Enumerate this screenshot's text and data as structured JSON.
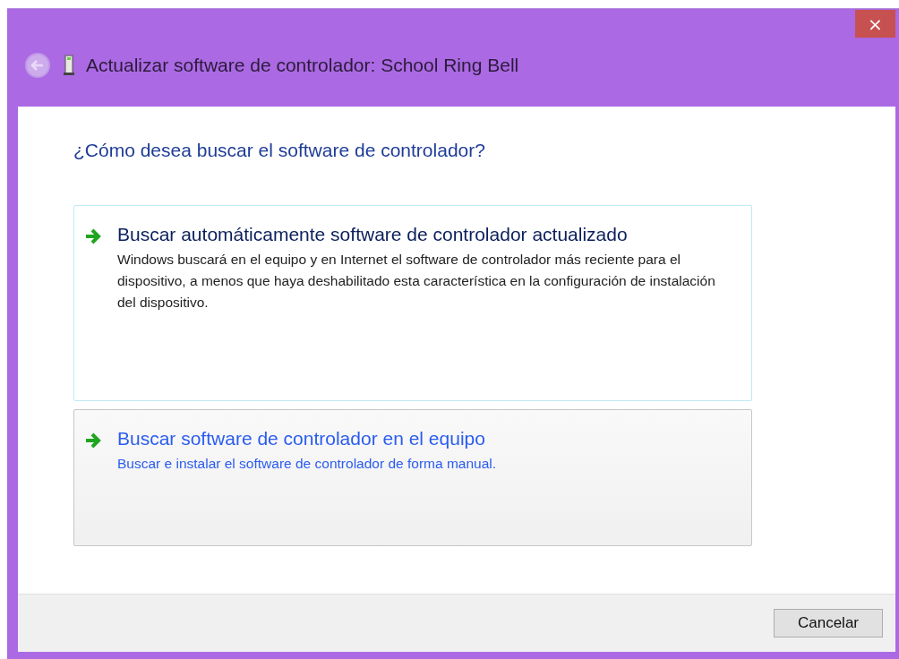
{
  "window": {
    "title": "Actualizar software de controlador: School Ring Bell",
    "close": "×",
    "back_button": {
      "disabled": true
    }
  },
  "heading": "¿Cómo desea buscar el software de controlador?",
  "options": [
    {
      "title": "Buscar automáticamente software de controlador actualizado",
      "description": "Windows buscará en el equipo y en Internet el software de controlador más reciente para el dispositivo, a menos que haya deshabilitado esta característica en la configuración de instalación del dispositivo.",
      "focused": true,
      "highlighted": false
    },
    {
      "title": "Buscar software de controlador en el equipo",
      "description": "Buscar e instalar el software de controlador de forma manual.",
      "focused": false,
      "highlighted": true
    }
  ],
  "buttons": [
    "Cancelar"
  ]
}
